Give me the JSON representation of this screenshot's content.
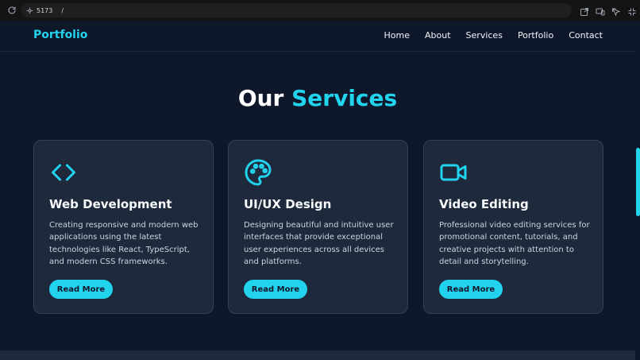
{
  "browser": {
    "url_port": "5173",
    "url_path": "/"
  },
  "nav": {
    "logo": "Portfolio",
    "links": [
      "Home",
      "About",
      "Services",
      "Portfolio",
      "Contact"
    ]
  },
  "section": {
    "title_part1": "Our",
    "title_part2": "Services"
  },
  "services": [
    {
      "icon": "code-icon",
      "title": "Web Development",
      "description": "Creating responsive and modern web applications using the latest technologies like React, TypeScript, and modern CSS frameworks.",
      "button": "Read More"
    },
    {
      "icon": "palette-icon",
      "title": "UI/UX Design",
      "description": "Designing beautiful and intuitive user interfaces that provide exceptional user experiences across all devices and platforms.",
      "button": "Read More"
    },
    {
      "icon": "video-camera-icon",
      "title": "Video Editing",
      "description": "Professional video editing services for promotional content, tutorials, and creative projects with attention to detail and storytelling.",
      "button": "Read More"
    }
  ],
  "colors": {
    "accent": "#22d3ee",
    "background": "#0f172a",
    "card": "#1e293b"
  }
}
